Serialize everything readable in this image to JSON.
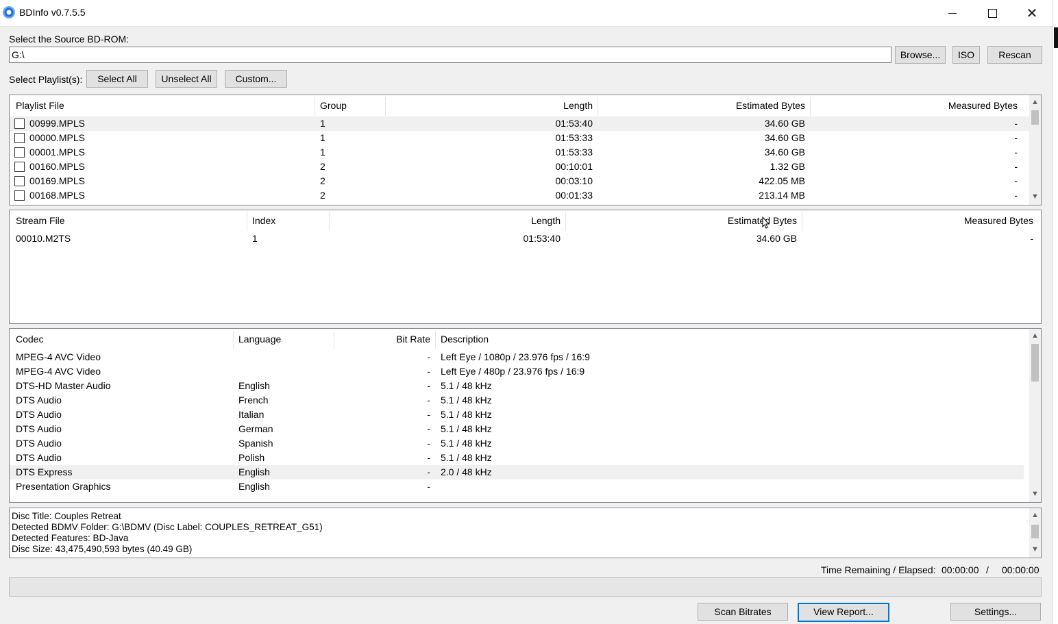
{
  "window": {
    "title": "BDInfo v0.7.5.5",
    "close_glyph": "✕"
  },
  "source": {
    "label": "Select the Source BD-ROM:",
    "path": "G:\\",
    "browse": "Browse...",
    "iso": "ISO",
    "rescan": "Rescan"
  },
  "playlist_controls": {
    "label": "Select Playlist(s):",
    "select_all": "Select All",
    "unselect_all": "Unselect All",
    "custom": "Custom..."
  },
  "playlists": {
    "headers": {
      "file": "Playlist File",
      "group": "Group",
      "length": "Length",
      "est": "Estimated Bytes",
      "meas": "Measured Bytes"
    },
    "rows": [
      {
        "file": "00999.MPLS",
        "group": "1",
        "length": "01:53:40",
        "est": "34.60 GB",
        "meas": "-"
      },
      {
        "file": "00000.MPLS",
        "group": "1",
        "length": "01:53:33",
        "est": "34.60 GB",
        "meas": "-"
      },
      {
        "file": "00001.MPLS",
        "group": "1",
        "length": "01:53:33",
        "est": "34.60 GB",
        "meas": "-"
      },
      {
        "file": "00160.MPLS",
        "group": "2",
        "length": "00:10:01",
        "est": "1.32 GB",
        "meas": "-"
      },
      {
        "file": "00169.MPLS",
        "group": "2",
        "length": "00:03:10",
        "est": "422.05 MB",
        "meas": "-"
      },
      {
        "file": "00168.MPLS",
        "group": "2",
        "length": "00:01:33",
        "est": "213.14 MB",
        "meas": "-"
      }
    ]
  },
  "streams": {
    "headers": {
      "file": "Stream File",
      "index": "Index",
      "length": "Length",
      "est": "Estimated Bytes",
      "meas": "Measured Bytes"
    },
    "rows": [
      {
        "file": "00010.M2TS",
        "index": "1",
        "length": "01:53:40",
        "est": "34.60 GB",
        "meas": "-"
      }
    ]
  },
  "codecs": {
    "headers": {
      "codec": "Codec",
      "language": "Language",
      "bitrate": "Bit Rate",
      "description": "Description"
    },
    "rows": [
      {
        "codec": "MPEG-4 AVC Video",
        "language": "",
        "bitrate": "-",
        "description": "Left Eye / 1080p / 23.976 fps / 16:9"
      },
      {
        "codec": "MPEG-4 AVC Video",
        "language": "",
        "bitrate": "-",
        "description": "Left Eye / 480p / 23.976 fps / 16:9"
      },
      {
        "codec": "DTS-HD Master Audio",
        "language": "English",
        "bitrate": "-",
        "description": "5.1 / 48 kHz"
      },
      {
        "codec": "DTS Audio",
        "language": "French",
        "bitrate": "-",
        "description": "5.1 / 48 kHz"
      },
      {
        "codec": "DTS Audio",
        "language": "Italian",
        "bitrate": "-",
        "description": "5.1 / 48 kHz"
      },
      {
        "codec": "DTS Audio",
        "language": "German",
        "bitrate": "-",
        "description": "5.1 / 48 kHz"
      },
      {
        "codec": "DTS Audio",
        "language": "Spanish",
        "bitrate": "-",
        "description": "5.1 / 48 kHz"
      },
      {
        "codec": "DTS Audio",
        "language": "Polish",
        "bitrate": "-",
        "description": "5.1 / 48 kHz"
      },
      {
        "codec": "DTS Express",
        "language": "English",
        "bitrate": "-",
        "description": "2.0 / 48 kHz"
      },
      {
        "codec": "Presentation Graphics",
        "language": "English",
        "bitrate": "-",
        "description": ""
      }
    ]
  },
  "disc_info": {
    "lines": [
      "Disc Title: Couples Retreat",
      "Detected BDMV Folder: G:\\BDMV (Disc Label: COUPLES_RETREAT_G51)",
      "Detected Features: BD-Java",
      "Disc Size: 43,475,490,593 bytes (40.49 GB)"
    ]
  },
  "status": {
    "time_label": "Time Remaining / Elapsed:",
    "remaining": "00:00:00",
    "separator": "/",
    "elapsed": "00:00:00",
    "progress": 0
  },
  "actions": {
    "scan": "Scan Bitrates",
    "report": "View Report...",
    "settings": "Settings..."
  }
}
